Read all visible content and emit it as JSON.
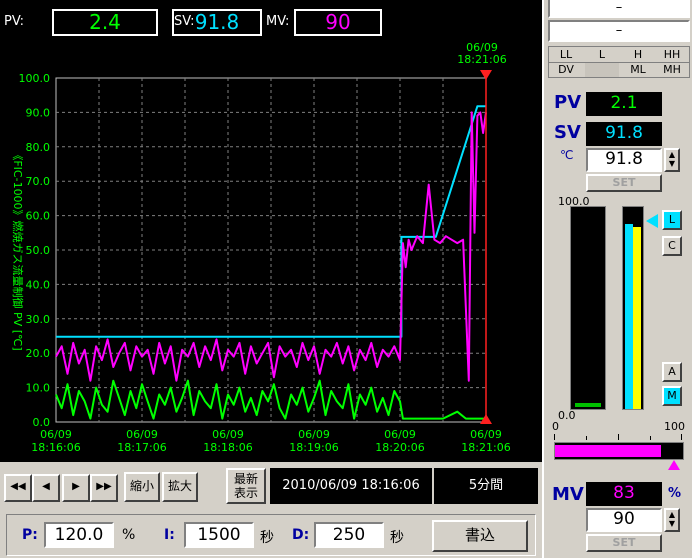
{
  "header": {
    "pv_label": "PV:",
    "pv_value": "2.4",
    "sv_label": "SV:",
    "sv_value": "91.8",
    "mv_label": "MV:",
    "mv_value": "90",
    "right_time_date": "06/09",
    "right_time_clock": "18:21:06"
  },
  "colors": {
    "pv": "#ff00ff",
    "sv": "#00e0ff",
    "mv": "#00ff00",
    "cursor": "#ff2020",
    "axis": "#00ff00"
  },
  "chart_data": {
    "type": "line",
    "ylabel": "《FIC-1000》燃焼ガス流量制御 PV [℃]",
    "ylim": [
      0,
      100
    ],
    "yticks": [
      "0.0",
      "10.0",
      "20.0",
      "30.0",
      "40.0",
      "50.0",
      "60.0",
      "70.0",
      "80.0",
      "90.0",
      "100.0"
    ],
    "xlim": [
      0,
      300
    ],
    "xticks": [
      {
        "t": 0,
        "date": "06/09",
        "time": "18:16:06"
      },
      {
        "t": 60,
        "date": "06/09",
        "time": "18:17:06"
      },
      {
        "t": 120,
        "date": "06/09",
        "time": "18:18:06"
      },
      {
        "t": 180,
        "date": "06/09",
        "time": "18:19:06"
      },
      {
        "t": 240,
        "date": "06/09",
        "time": "18:20:06"
      },
      {
        "t": 300,
        "date": "06/09",
        "time": "18:21:06"
      }
    ],
    "grid": true,
    "cursor_t": 300,
    "series": [
      {
        "key": "sv",
        "color": "#00e0ff",
        "x": [
          0,
          241,
          241,
          265,
          265,
          294,
          294,
          300
        ],
        "y": [
          24.8,
          24.8,
          53.8,
          53.8,
          53.8,
          91.8,
          91.8,
          91.8
        ]
      },
      {
        "key": "pv",
        "color": "#ff00ff",
        "x": [
          0,
          4,
          8,
          12,
          16,
          20,
          24,
          28,
          32,
          36,
          40,
          44,
          48,
          52,
          56,
          60,
          64,
          68,
          72,
          76,
          80,
          84,
          88,
          92,
          96,
          100,
          104,
          108,
          112,
          116,
          120,
          124,
          128,
          132,
          136,
          140,
          144,
          148,
          152,
          156,
          160,
          164,
          168,
          172,
          176,
          180,
          184,
          188,
          192,
          196,
          200,
          204,
          208,
          212,
          216,
          220,
          224,
          228,
          232,
          236,
          240,
          242,
          244,
          246,
          248,
          252,
          256,
          260,
          264,
          268,
          272,
          276,
          280,
          284,
          288,
          290,
          292,
          294,
          296,
          298,
          300
        ],
        "y": [
          19,
          22,
          14,
          23,
          17,
          21,
          12,
          22,
          18,
          24,
          16,
          20,
          23,
          15,
          22,
          19,
          21,
          14,
          23,
          17,
          22,
          12,
          21,
          19,
          23,
          16,
          22,
          18,
          24,
          15,
          21,
          19,
          23,
          14,
          22,
          17,
          20,
          23,
          13,
          22,
          19,
          21,
          16,
          23,
          18,
          22,
          14,
          21,
          19,
          23,
          17,
          22,
          15,
          21,
          18,
          23,
          16,
          21,
          19,
          22,
          18,
          52,
          45,
          53,
          50,
          54,
          52,
          69,
          53,
          52,
          54,
          53,
          52,
          53,
          12,
          90,
          55,
          89,
          90,
          84,
          90
        ]
      },
      {
        "key": "mv",
        "color": "#00ff00",
        "x": [
          0,
          4,
          8,
          12,
          16,
          20,
          24,
          28,
          32,
          36,
          40,
          44,
          48,
          52,
          56,
          60,
          64,
          68,
          72,
          76,
          80,
          84,
          88,
          92,
          96,
          100,
          104,
          108,
          112,
          116,
          120,
          124,
          128,
          132,
          136,
          140,
          144,
          148,
          152,
          156,
          160,
          164,
          168,
          172,
          176,
          180,
          184,
          188,
          192,
          196,
          200,
          204,
          208,
          212,
          216,
          220,
          224,
          228,
          232,
          236,
          240,
          242,
          244,
          250,
          260,
          270,
          280,
          286,
          290,
          294,
          300
        ],
        "y": [
          8,
          4,
          11,
          2,
          9,
          6,
          1,
          10,
          5,
          3,
          12,
          7,
          2,
          9,
          4,
          11,
          6,
          1,
          8,
          5,
          10,
          3,
          7,
          12,
          2,
          9,
          6,
          4,
          11,
          1,
          8,
          5,
          10,
          3,
          7,
          2,
          9,
          6,
          11,
          4,
          1,
          8,
          5,
          10,
          3,
          7,
          12,
          2,
          9,
          6,
          4,
          11,
          1,
          8,
          5,
          10,
          3,
          7,
          2,
          9,
          6,
          1,
          1,
          1,
          1,
          1,
          3,
          1,
          1,
          1,
          1
        ]
      }
    ]
  },
  "nav": {
    "first": "◀◀",
    "prev": "◀",
    "next": "▶",
    "last": "▶▶",
    "zoom_out": "縮小",
    "zoom_in": "拡大",
    "latest_line1": "最新",
    "latest_line2": "表示",
    "start_time": "2010/06/09 18:16:06",
    "span": "5分間"
  },
  "pid": {
    "p_label": "P:",
    "p_value": "120.0",
    "p_unit": "%",
    "i_label": "I:",
    "i_value": "1500",
    "i_unit": "秒",
    "d_label": "D:",
    "d_value": "250",
    "d_unit": "秒",
    "write_label": "書込"
  },
  "faceplate": {
    "top1": "–",
    "top2": "–",
    "alarm": [
      "LL",
      "L",
      "H",
      "HH",
      "DV",
      "",
      "ML",
      "MH"
    ],
    "pv_label": "PV",
    "pv_value": "2.1",
    "sv_label": "SV",
    "sv_value": "91.8",
    "unit": "℃",
    "sv_input": "91.8",
    "set_label": "SET",
    "bar_top": "100.0",
    "bar_bottom": "0.0",
    "pv_bar_level": 2.1,
    "sv_bar_level": 91.8,
    "mv_bar_level2": 90,
    "l_label": "L",
    "c_label": "C",
    "a_label": "A",
    "m_label": "M",
    "mv_scale_min": "0",
    "mv_scale_max": "100",
    "mv_bar_level": 83,
    "mv_label": "MV",
    "mv_value": "83",
    "mv_unit": "%",
    "mv_input": "90",
    "mv_set_label": "SET"
  }
}
